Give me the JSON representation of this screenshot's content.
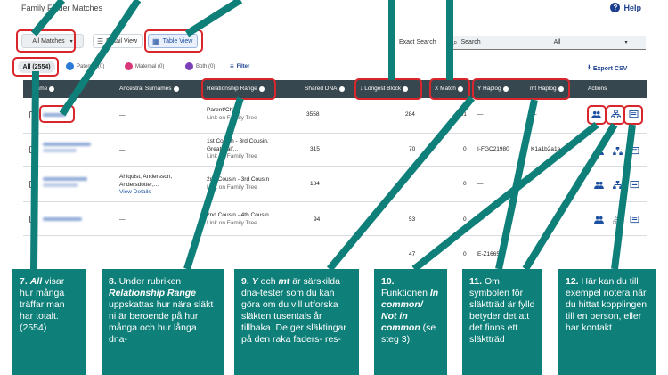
{
  "header": {
    "title": "Family Finder Matches",
    "help": "Help"
  },
  "toolbar": {
    "all_matches": "All Matches",
    "detail_view": "Detail View",
    "table_view": "Table View",
    "exact_search": "Exact Search",
    "search_placeholder": "Search",
    "search_select": "All"
  },
  "filters": {
    "all": "All (2554)",
    "paternal": "Paternal (0)",
    "maternal": "Maternal (0)",
    "both": "Both (0)",
    "filter": "Filter",
    "export": "Export CSV"
  },
  "columns": [
    "Name",
    "Ancestral Surnames",
    "Relationship Range",
    "Shared DNA",
    "Longest Block",
    "X Match",
    "Y Haplog",
    "mt Haplog",
    "Actions"
  ],
  "rows": [
    {
      "surnames": "—",
      "rel1": "Parent/Child",
      "rel2": "Link on Family Tree",
      "dna": "3558",
      "block": "284",
      "x": "181",
      "y": "—",
      "mt": "—"
    },
    {
      "surnames": "—",
      "rel1": "1st Cousin - 3rd Cousin,",
      "rel2": "Great/Half...",
      "rel3": "Link on Family Tree",
      "dna": "315",
      "block": "70",
      "x": "0",
      "y": "I-FGC21980",
      "mt": "K1a1b2a1a"
    },
    {
      "surnames": "Ahlquist, Andersson,",
      "surnames2": "Andersdotter,...",
      "details": "View Details",
      "rel1": "2nd Cousin - 3rd Cousin",
      "rel2": "Link on Family Tree",
      "dna": "184",
      "block": "",
      "x": "0",
      "y": "—",
      "mt": ""
    },
    {
      "surnames": "—",
      "rel1": "2nd Cousin - 4th Cousin",
      "rel2": "Link on Family Tree",
      "dna": "94",
      "block": "53",
      "x": "0",
      "y": "—",
      "mt": ""
    },
    {
      "surnames": "",
      "rel1": "",
      "rel2": "",
      "dna": "",
      "block": "47",
      "x": "0",
      "y": "E-Z16659",
      "mt": ""
    }
  ],
  "callouts": [
    {
      "num": "7.",
      "em": "All",
      "text": " visar hur många träffar man har totalt. (2554)"
    },
    {
      "num": "8.",
      "pre": " Under rubriken ",
      "em": "Relationship Range",
      "text": " uppskattas hur nära släkt ni är beroende på hur många och hur långa dna-"
    },
    {
      "num": "9.",
      "em": "Y",
      "mid": " och ",
      "em2": "mt",
      "text": " är särskilda dna-tester som du kan göra om du vill utforska släkten tusentals år tillbaka. De ger släktingar på den raka faders- res-"
    },
    {
      "num": "10.",
      "pre": " Funktionen ",
      "em": "In common/ Not in common",
      "text": " (se steg 3)."
    },
    {
      "num": "11.",
      "text": " Om symbolen för släktträd är fylld betyder det att det finns ett släktträd"
    },
    {
      "num": "12.",
      "text": " Här kan du till exempel notera när du hittat kopplingen till en person, eller har kontakt"
    }
  ],
  "colors": {
    "accent": "#0f7f79",
    "highlight": "#d9262c",
    "header": "#37474f",
    "link": "#1d4fa0"
  }
}
